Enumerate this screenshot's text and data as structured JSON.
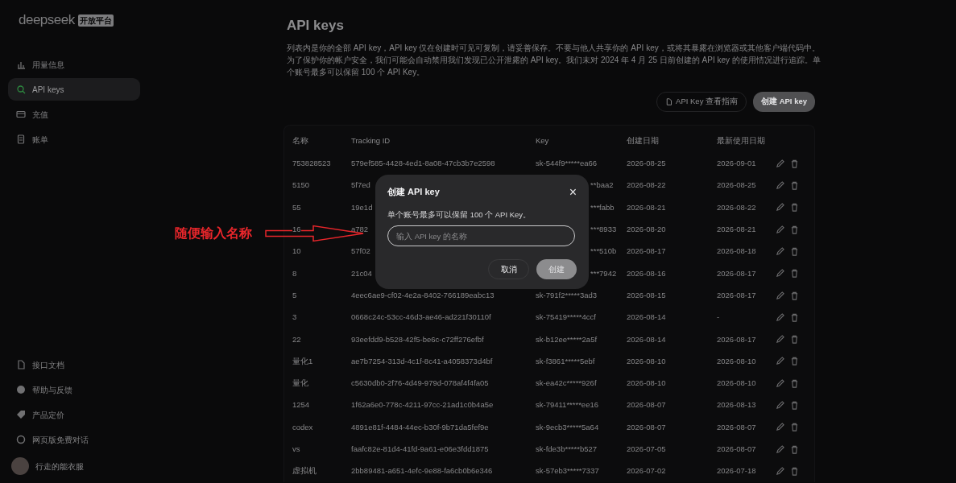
{
  "sidebar": {
    "logo": "deepseek",
    "logo_badge": "开放平台",
    "items": [
      {
        "label": "用量信息",
        "selected": false
      },
      {
        "label": "API keys",
        "selected": true
      },
      {
        "label": "充值",
        "selected": false
      },
      {
        "label": "账单",
        "selected": false
      }
    ],
    "bottom_items": [
      {
        "label": "接口文档"
      },
      {
        "label": "帮助与反馈"
      },
      {
        "label": "产品定价"
      },
      {
        "label": "网页版免费对话"
      }
    ],
    "user": {
      "name": "行走的能衣服"
    }
  },
  "page": {
    "title": "API keys",
    "description": "列表内是你的全部 API key，API key 仅在创建时可见可复制，请妥善保存。不要与他人共享你的 API key，或将其暴露在浏览器或其他客户端代码中。为了保护你的帐户安全，我们可能会自动禁用我们发现已公开泄露的 API key。我们未对 2024 年 4 月 25 日前创建的 API key 的使用情况进行追踪。单个账号最多可以保留 100 个 API Key。",
    "guide_button": "API Key 查看指南",
    "create_button": "创建 API key"
  },
  "table": {
    "columns": [
      "名称",
      "Tracking ID",
      "Key",
      "创建日期",
      "最新使用日期"
    ],
    "rows": [
      {
        "covered": false,
        "cells": [
          "753828523",
          "579ef585-4428-4ed1-8a08-47cb3b7e2598",
          "sk-544f9*****ea66",
          "2026-08-25",
          "2026-09-01"
        ]
      },
      {
        "covered": true,
        "cells": [
          "5150",
          "5f7ed",
          "**baa2",
          "2026-08-22",
          "2026-08-25"
        ]
      },
      {
        "covered": true,
        "cells": [
          "55",
          "19e1d",
          "***fabb",
          "2026-08-21",
          "2026-08-22"
        ]
      },
      {
        "covered": true,
        "cells": [
          "16",
          "a782",
          "***8933",
          "2026-08-20",
          "2026-08-21"
        ]
      },
      {
        "covered": true,
        "cells": [
          "10",
          "57f02",
          "***510b",
          "2026-08-17",
          "2026-08-18"
        ]
      },
      {
        "covered": true,
        "cells": [
          "8",
          "21c04",
          "***7942",
          "2026-08-16",
          "2026-08-17"
        ]
      },
      {
        "covered": false,
        "cells": [
          "5",
          "4eec6ae9-cf02-4e2a-8402-766189eabc13",
          "sk-791f2*****3ad3",
          "2026-08-15",
          "2026-08-17"
        ]
      },
      {
        "covered": false,
        "cells": [
          "3",
          "0668c24c-53cc-46d3-ae46-ad221f30110f",
          "sk-75419*****4ccf",
          "2026-08-14",
          "-"
        ]
      },
      {
        "covered": false,
        "cells": [
          "22",
          "93eefdd9-b528-42f5-be6c-c72ff276efbf",
          "sk-b12ee*****2a5f",
          "2026-08-14",
          "2026-08-17"
        ]
      },
      {
        "covered": false,
        "cells": [
          "量化1",
          "ae7b7254-313d-4c1f-8c41-a4058373d4bf",
          "sk-f3861*****5ebf",
          "2026-08-10",
          "2026-08-10"
        ]
      },
      {
        "covered": false,
        "cells": [
          "量化",
          "c5630db0-2f76-4d49-979d-078af4f4fa05",
          "sk-ea42c*****926f",
          "2026-08-10",
          "2026-08-10"
        ]
      },
      {
        "covered": false,
        "cells": [
          "1254",
          "1f62a6e0-778c-4211-97cc-21ad1c0b4a5e",
          "sk-79411*****ee16",
          "2026-08-07",
          "2026-08-13"
        ]
      },
      {
        "covered": false,
        "cells": [
          "codex",
          "4891e81f-4484-44ec-b30f-9b71da5fef9e",
          "sk-9ecb3*****5a64",
          "2026-08-07",
          "2026-08-07"
        ]
      },
      {
        "covered": false,
        "cells": [
          "vs",
          "faafc82e-81d4-41fd-9a61-e06e3fdd1875",
          "sk-fde3b*****b527",
          "2026-07-05",
          "2026-08-07"
        ]
      },
      {
        "covered": false,
        "cells": [
          "虚拟机",
          "2bb89481-a651-4efc-9e88-fa6cb0b6e346",
          "sk-57eb3*****7337",
          "2026-07-02",
          "2026-07-18"
        ]
      }
    ]
  },
  "dialog": {
    "title": "创建 API key",
    "close": "×",
    "message": "单个账号最多可以保留 100 个 API Key。",
    "input": {
      "placeholder": "输入 API key 的名称"
    },
    "cancel_button": "取消",
    "create_button": "创建"
  },
  "annotation": {
    "text": "随便输入名称"
  }
}
